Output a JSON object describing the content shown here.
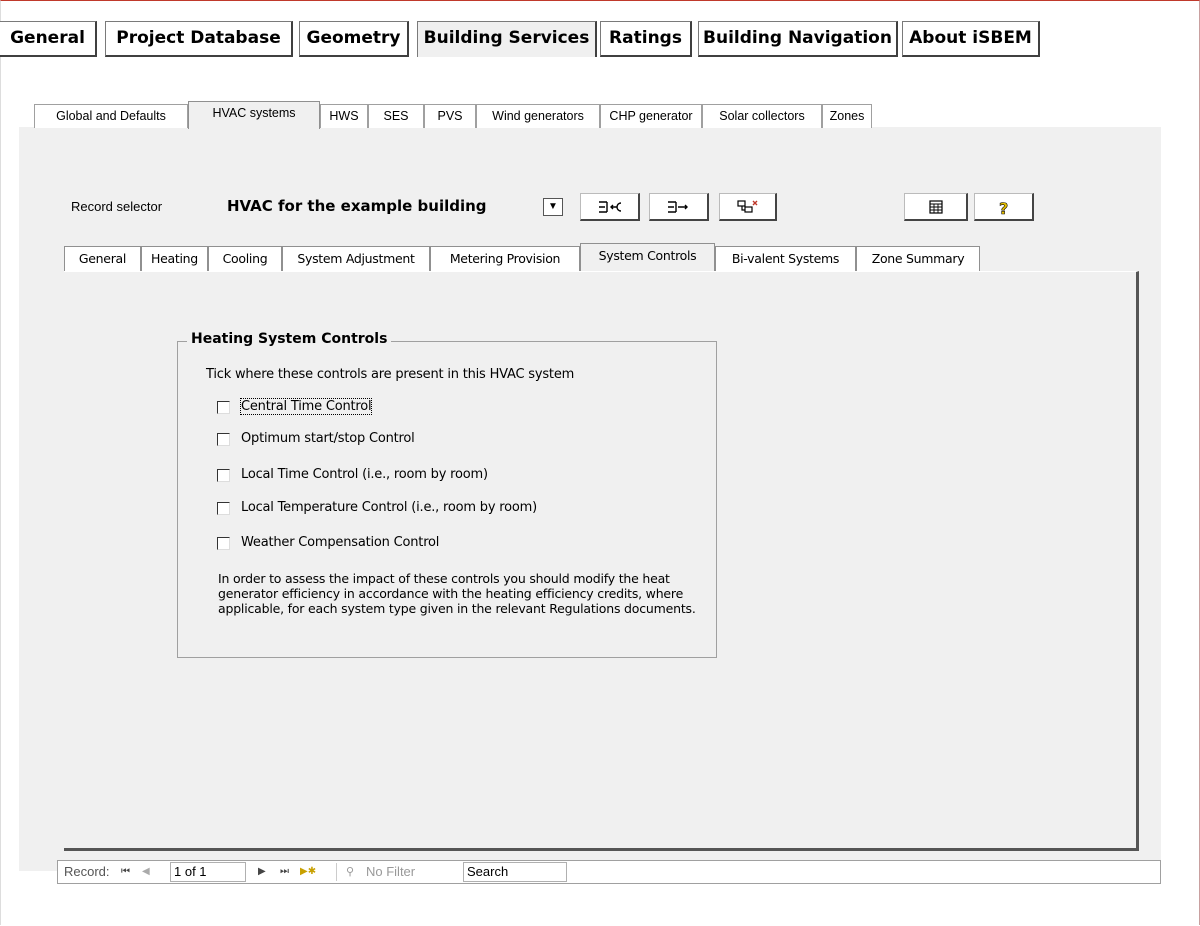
{
  "main_tabs": [
    "General",
    "Project Database",
    "Geometry",
    "Building Services",
    "Ratings",
    "Building Navigation",
    "About iSBEM"
  ],
  "sub_tabs": [
    "Global and Defaults",
    "HVAC systems",
    "HWS",
    "SES",
    "PVS",
    "Wind generators",
    "CHP generator",
    "Solar collectors",
    "Zones"
  ],
  "record_selector": {
    "label": "Record selector",
    "value": "HVAC for the example building"
  },
  "toolbar_icons": [
    "add-record-icon",
    "copy-record-icon",
    "delete-record-icon",
    "calculator-icon",
    "help-icon"
  ],
  "inner_tabs": [
    "General",
    "Heating",
    "Cooling",
    "System Adjustment",
    "Metering Provision",
    "System Controls",
    "Bi-valent Systems",
    "Zone Summary"
  ],
  "heating_controls": {
    "title": "Heating System Controls",
    "intro": "Tick where these controls are present in this HVAC system",
    "items": [
      {
        "label": "Central Time Control",
        "checked": false
      },
      {
        "label": "Optimum start/stop Control",
        "checked": false
      },
      {
        "label": "Local Time Control (i.e., room by room)",
        "checked": false
      },
      {
        "label": "Local Temperature Control (i.e., room by room)",
        "checked": false
      },
      {
        "label": "Weather Compensation Control",
        "checked": false
      }
    ],
    "note": "In order to assess the impact of these controls you should modify the heat generator efficiency in accordance with the heating efficiency credits, where applicable, for each system type given in the relevant Regulations documents."
  },
  "record_nav": {
    "label": "Record:",
    "current": "1 of 1",
    "filter": "No Filter",
    "search": "Search"
  }
}
